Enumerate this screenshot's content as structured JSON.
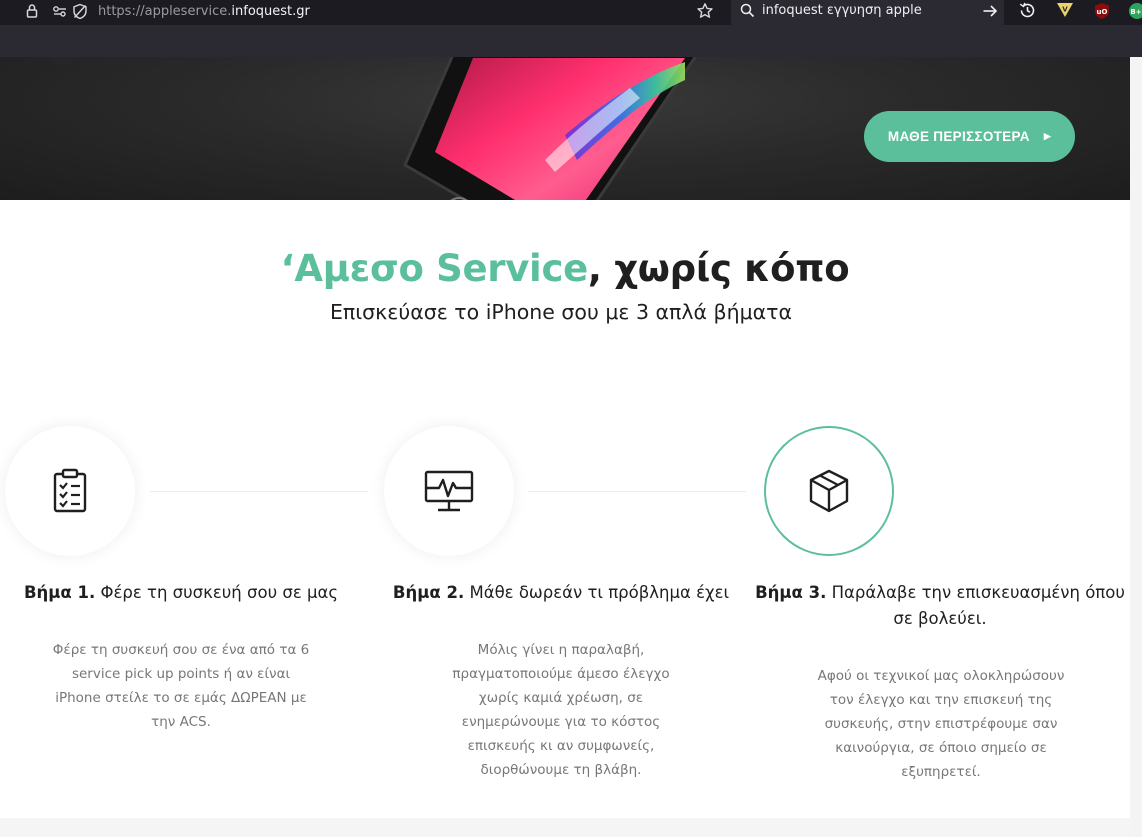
{
  "browser": {
    "url_prefix": "https://appleservice.",
    "url_host": "infoquest.gr",
    "search_query": "infoquest εγγυηση apple"
  },
  "hero": {
    "cta_label": "ΜΑΘΕ ΠΕΡΙΣΣΟΤΕΡΑ",
    "cta_arrow": "▶"
  },
  "heading": {
    "accent": "‘Αμεσο Service",
    "rest": ", χωρίς κόπο",
    "subtitle": "Επισκεύασε το iPhone σου με 3 απλά βήματα"
  },
  "steps": [
    {
      "number": "Βήμα 1.",
      "title": " Φέρε τη συσκευή σου σε μας",
      "desc_lines": [
        "Φέρε τη συσκευή σου σε ένα από τα 6",
        "service pick up points ή αν είναι",
        "iPhone στείλε το σε εμάς ΔΩΡΕΑΝ με",
        "την ACS."
      ]
    },
    {
      "number": "Βήμα 2.",
      "title": " Μάθε δωρεάν τι πρόβλημα έχει",
      "desc_lines": [
        "Μόλις γίνει η παραλαβή,",
        "πραγματοποιούμε άμεσο έλεγχο",
        "χωρίς καμιά χρέωση, σε",
        "ενημερώνουμε για το κόστος",
        "επισκευής κι αν συμφωνείς,",
        "διορθώνουμε τη βλάβη."
      ]
    },
    {
      "number": "Βήμα 3.",
      "title": " Παράλαβε την επισκευασμένη όπου",
      "title_line2": "σε βολεύει.",
      "desc_lines": [
        "Αφού οι τεχνικοί μας ολοκληρώσουν",
        "τον έλεγχο και την επισκευή της",
        "συσκευής, στην επιστρέφουμε σαν",
        "καινούργια, σε όποιο σημείο σε",
        "εξυπηρετεί."
      ]
    }
  ],
  "colors": {
    "accent": "#5cbf9c",
    "text_dark": "#1f1f1f",
    "text_muted": "#777777"
  }
}
